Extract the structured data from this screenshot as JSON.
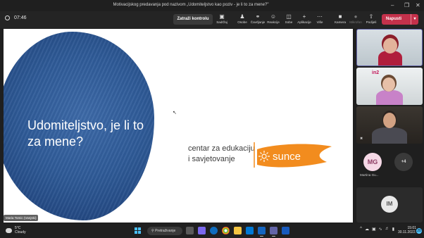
{
  "window": {
    "title": "Motivacijskog predavanja pod nazivom „Udomiteljstvo kao poziv - je li to za mene?\"",
    "minimize_icon": "minimize-icon",
    "maximize_icon": "maximize-icon",
    "close_icon": "close-icon"
  },
  "meeting_toolbar": {
    "timer": "07:46",
    "request_control_label": "Zatraži kontrolu",
    "buttons": [
      {
        "label": "Sadržaj",
        "icon": "content-icon"
      },
      {
        "label": "Osobe",
        "icon": "people-icon"
      },
      {
        "label": "Čavrljanje",
        "icon": "chat-icon"
      },
      {
        "label": "Reakcije",
        "icon": "reactions-icon"
      },
      {
        "label": "Sobe",
        "icon": "rooms-icon"
      },
      {
        "label": "Aplikacije",
        "icon": "apps-icon"
      },
      {
        "label": "Više",
        "icon": "more-icon"
      },
      {
        "label": "Kamera",
        "icon": "camera-icon"
      },
      {
        "label": "Mikrofon",
        "icon": "microphone-icon"
      },
      {
        "label": "Podijeli",
        "icon": "share-icon"
      }
    ],
    "leave_label": "Napusti",
    "leave_color": "#c4314b"
  },
  "slide": {
    "title": "Udomiteljstvo, je li to za mene?",
    "org_line1": "centar za edukaciju",
    "org_line2": "i savjetovanje",
    "logo_text": "sunce",
    "logo_color": "#f28c1e",
    "blob_color": "#2f5b98"
  },
  "presenter": {
    "name_tag": "Maria Tomic (Vanjski)"
  },
  "participants": {
    "tile2_logo": "in2",
    "avatar_mg": "MG",
    "avatar_mg_name": "Martina Gu...",
    "overflow": "+4",
    "avatar_im": "IM"
  },
  "taskbar": {
    "temperature": "5°C",
    "weather": "Cloudy",
    "search_label": "Pretraživanje",
    "time": "15:01",
    "date": "30.11.2022.",
    "notification_count": "20"
  }
}
